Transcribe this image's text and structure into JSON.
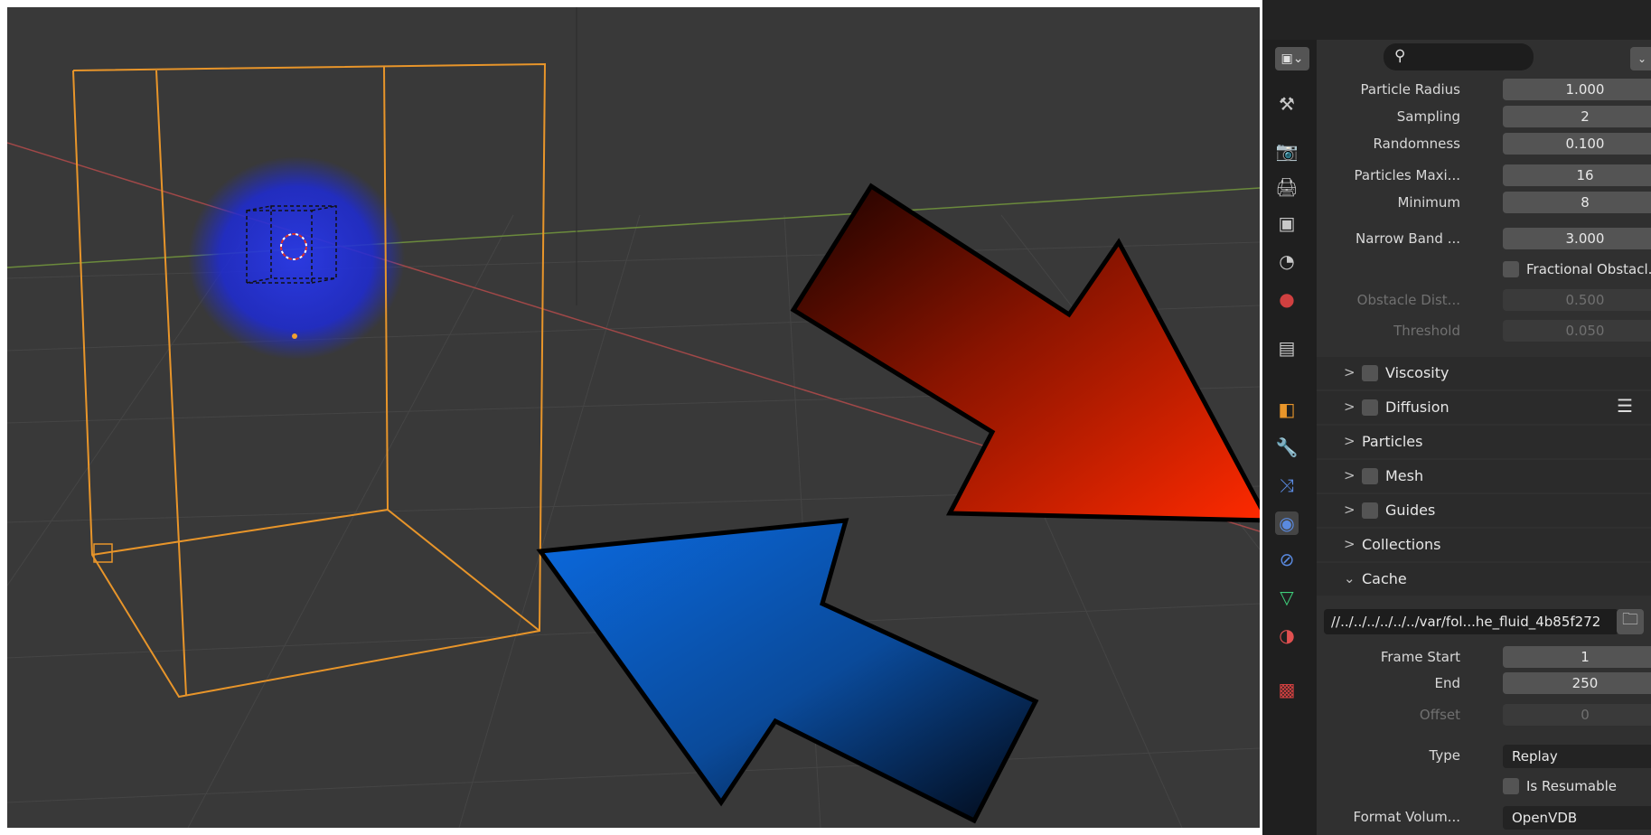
{
  "search": {
    "icon": "search-icon"
  },
  "properties": {
    "particle_radius": {
      "label": "Particle Radius",
      "value": "1.000"
    },
    "sampling": {
      "label": "Sampling",
      "value": "2"
    },
    "randomness": {
      "label": "Randomness",
      "value": "0.100"
    },
    "particles_max": {
      "label": "Particles Maxi...",
      "value": "16"
    },
    "minimum": {
      "label": "Minimum",
      "value": "8"
    },
    "narrow_band": {
      "label": "Narrow Band ...",
      "value": "3.000"
    },
    "fractional_obstacles": {
      "label": "Fractional Obstacl...",
      "checked": false
    },
    "obstacle_distance": {
      "label": "Obstacle Dist...",
      "value": "0.500"
    },
    "threshold": {
      "label": "Threshold",
      "value": "0.050"
    }
  },
  "sections": {
    "viscosity": "Viscosity",
    "diffusion": "Diffusion",
    "particles": "Particles",
    "mesh": "Mesh",
    "guides": "Guides",
    "collections": "Collections",
    "cache": "Cache"
  },
  "cache": {
    "path": "//../../../../../../var/fol...he_fluid_4b85f272",
    "frame_start": {
      "label": "Frame Start",
      "value": "1"
    },
    "end": {
      "label": "End",
      "value": "250"
    },
    "offset": {
      "label": "Offset",
      "value": "0"
    },
    "type": {
      "label": "Type",
      "value": "Replay"
    },
    "is_resumable": {
      "label": "Is Resumable",
      "checked": false
    },
    "format_volumes": {
      "label": "Format Volum...",
      "value": "OpenVDB"
    }
  },
  "colors": {
    "viewport_bg": "#393939",
    "panel_bg": "#303030",
    "domain_outline": "#e8952a",
    "particles": "#1e2bd6",
    "arrow_red": "#e62205",
    "arrow_blue": "#0960c4"
  }
}
